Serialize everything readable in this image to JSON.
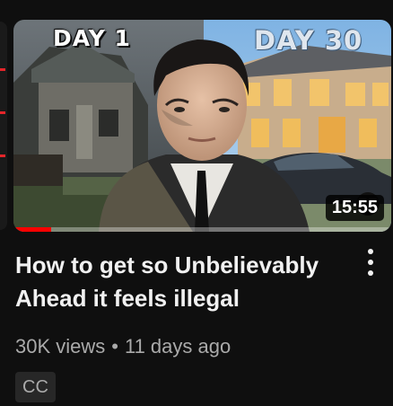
{
  "video": {
    "title": "How to get so Unbelievably Ahead it feels illegal",
    "thumbnail": {
      "left_text": "DAY 1",
      "right_text": "DAY 30"
    },
    "duration": "15:55",
    "watch_progress_percent": 10,
    "views": "30K views",
    "separator": "•",
    "age": "11 days ago",
    "badge": "CC"
  },
  "icons": {
    "menu": "more-vert-icon"
  },
  "colors": {
    "background": "#0f0f0f",
    "progress": "#ff0000",
    "text_primary": "#f1f1f1",
    "text_secondary": "#aaaaaa",
    "badge_bg": "#272727"
  }
}
